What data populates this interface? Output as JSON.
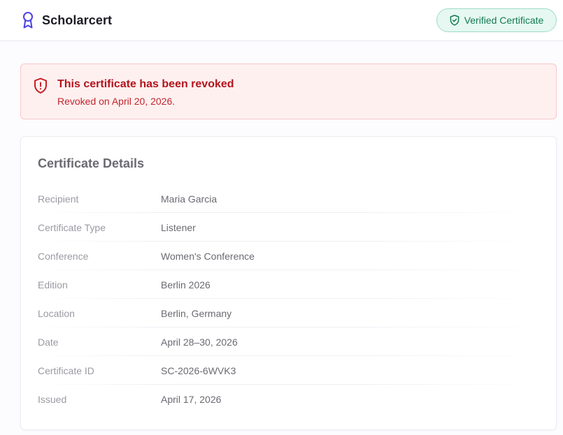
{
  "header": {
    "brand_name": "Scholarcert",
    "brand_icon": "award-ribbon-icon",
    "verified_badge": {
      "label": "Verified Certificate",
      "icon": "shield-check-icon"
    }
  },
  "alert": {
    "icon": "shield-alert-icon",
    "title": "This certificate has been revoked",
    "message": "Revoked on April 20, 2026."
  },
  "details": {
    "title": "Certificate Details",
    "rows": [
      {
        "label": "Recipient",
        "value": "Maria Garcia"
      },
      {
        "label": "Certificate Type",
        "value": "Listener"
      },
      {
        "label": "Conference",
        "value": "Women's Conference"
      },
      {
        "label": "Edition",
        "value": "Berlin 2026"
      },
      {
        "label": "Location",
        "value": "Berlin, Germany"
      },
      {
        "label": "Date",
        "value": "April 28–30, 2026"
      },
      {
        "label": "Certificate ID",
        "value": "SC-2026-6WVK3"
      },
      {
        "label": "Issued",
        "value": "April 17, 2026"
      }
    ]
  },
  "colors": {
    "brand": "#4f46e5",
    "verified_text": "#137a55",
    "verified_bg": "#e6f8f1",
    "alert_text": "#b3141c",
    "alert_bg": "#fff0f0"
  }
}
